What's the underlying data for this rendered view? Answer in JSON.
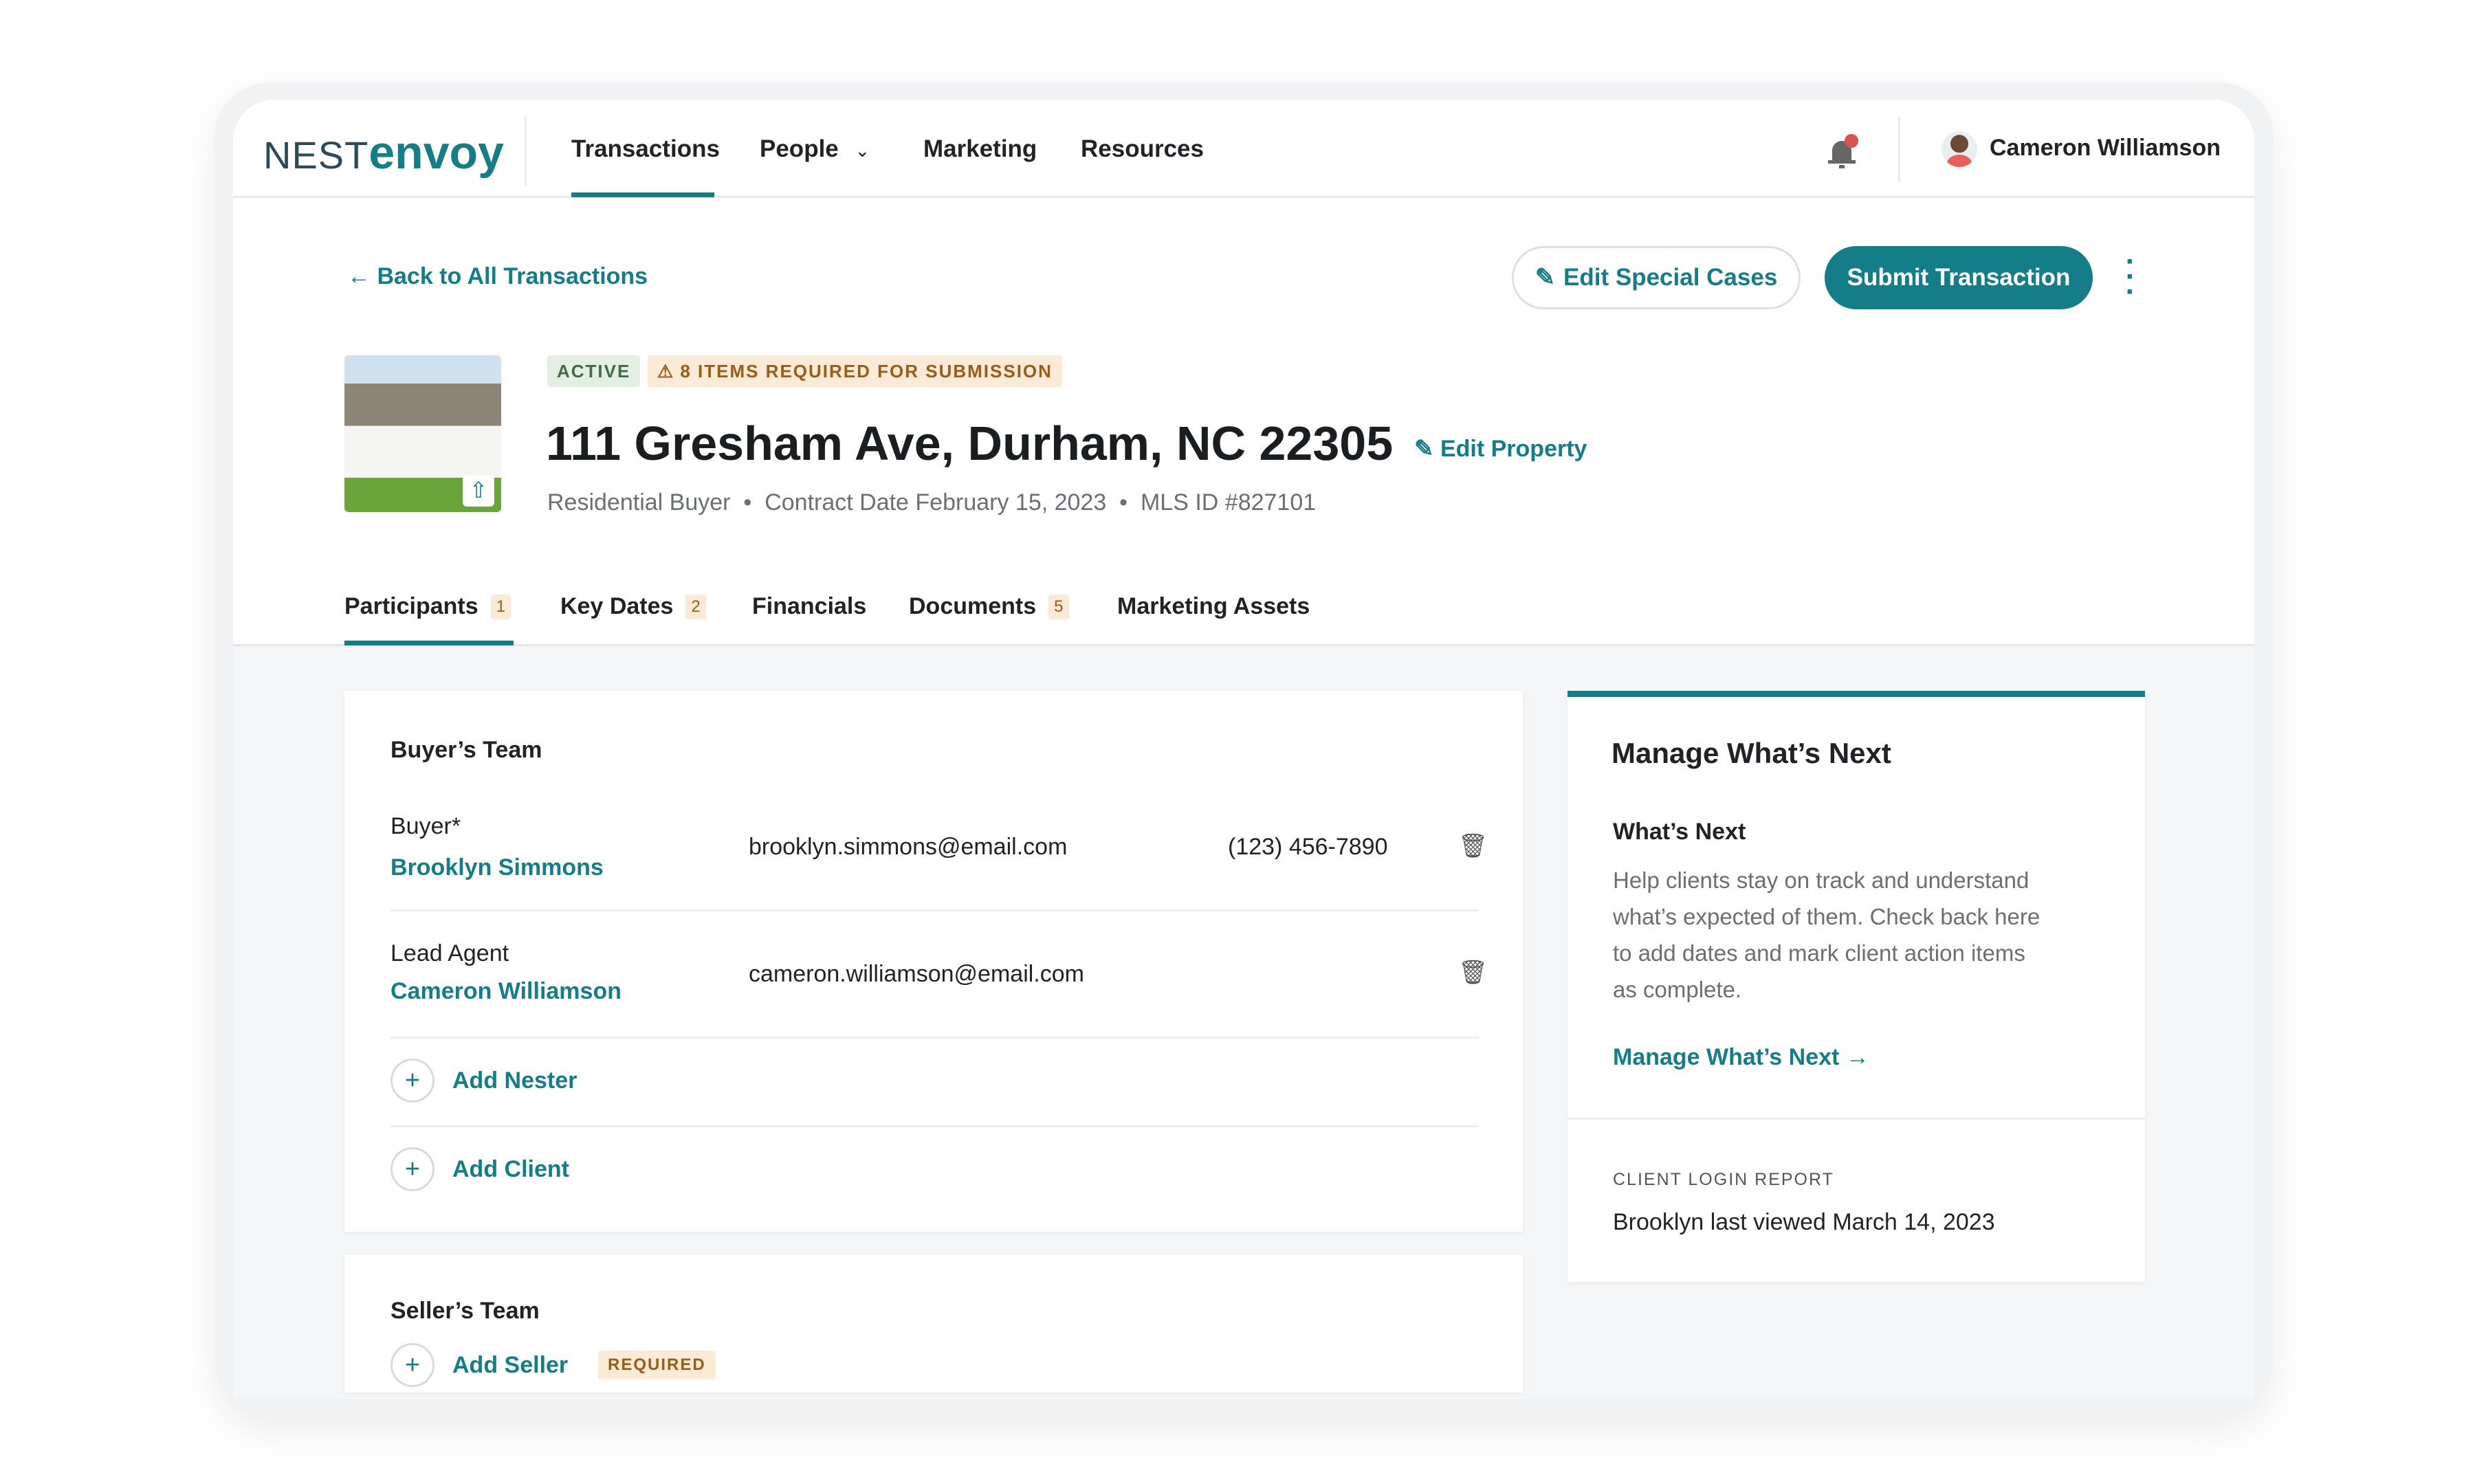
{
  "brand": {
    "part1": "NEST",
    "part2": "envoy"
  },
  "nav": {
    "items": [
      "Transactions",
      "People",
      "Marketing",
      "Resources"
    ],
    "active": "Transactions",
    "user_name": "Cameron Williamson",
    "notification_dot": true
  },
  "colors": {
    "accent": "#137e88",
    "warning": "#9a5d16",
    "active_badge_bg": "#e4efe4"
  },
  "actions": {
    "back": "Back to All Transactions",
    "edit_special": "Edit Special Cases",
    "submit": "Submit Transaction"
  },
  "property": {
    "status": "ACTIVE",
    "warning": "8 ITEMS REQUIRED FOR SUBMISSION",
    "address": "111 Gresham Ave, Durham, NC 22305",
    "edit": "Edit Property",
    "type": "Residential Buyer",
    "contract": "Contract Date February 15, 2023",
    "mls": "MLS ID #827101",
    "separator": "•"
  },
  "tabs": [
    {
      "label": "Participants",
      "count": "1"
    },
    {
      "label": "Key Dates",
      "count": "2"
    },
    {
      "label": "Financials"
    },
    {
      "label": "Documents",
      "count": "5"
    },
    {
      "label": "Marketing Assets"
    }
  ],
  "buyers_team": {
    "title": "Buyer’s Team",
    "rows": [
      {
        "role": "Buyer*",
        "name": "Brooklyn Simmons",
        "email": "brooklyn.simmons@email.com",
        "phone": "(123) 456-7890"
      },
      {
        "role": "Lead Agent",
        "name": "Cameron Williamson",
        "email": "cameron.williamson@email.com"
      }
    ],
    "add_nester": "Add Nester",
    "add_client": "Add Client"
  },
  "sellers_team": {
    "title": "Seller’s Team",
    "add_seller": "Add Seller",
    "required": "REQUIRED"
  },
  "whats_next": {
    "title": "Manage What’s Next",
    "subtitle": "What’s Next",
    "body": [
      "Help clients stay on track and understand",
      "what’s expected of them. Check back here",
      "to add dates and mark client action items",
      "as complete."
    ],
    "link": "Manage What’s Next",
    "report_label": "CLIENT LOGIN REPORT",
    "report_value": "Brooklyn last viewed March 14, 2023"
  }
}
